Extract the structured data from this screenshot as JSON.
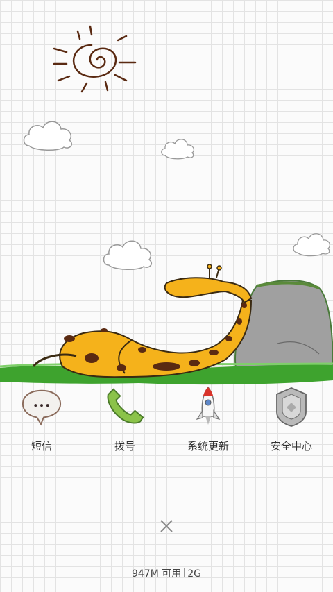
{
  "apps": [
    {
      "label": "短信",
      "icon": "message-bubble-icon"
    },
    {
      "label": "拨号",
      "icon": "phone-handset-icon"
    },
    {
      "label": "系统更新",
      "icon": "rocket-icon"
    },
    {
      "label": "安全中心",
      "icon": "shield-icon"
    }
  ],
  "status": {
    "memory": "947M 可用",
    "network": "2G"
  },
  "close_icon": "close-x-icon",
  "colors": {
    "giraffe": "#f5b21b",
    "spots": "#5a2a12",
    "grass": "#3ea32e",
    "rock": "#9a9a9a",
    "phone": "#8bc34a"
  }
}
